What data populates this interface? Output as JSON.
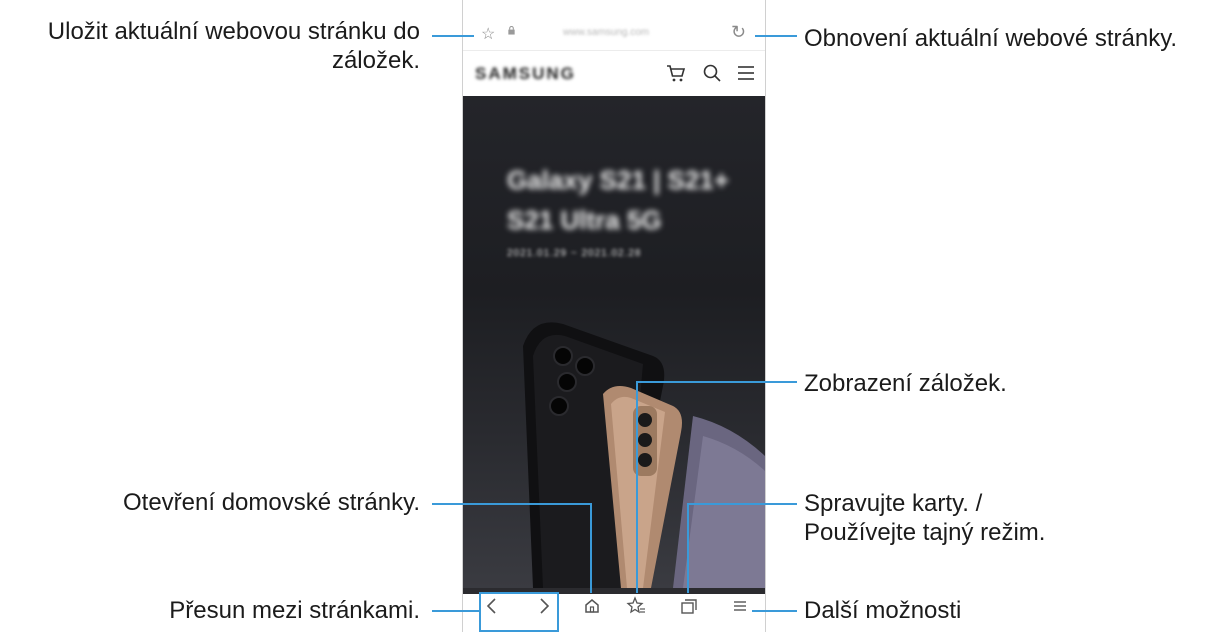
{
  "browser": {
    "url": "www.samsung.com",
    "site_logo": "SAMSUNG",
    "hero_title": "Galaxy S21 | S21+\nS21 Ultra 5G",
    "hero_date": "2021.01.29 ~ 2021.02.28"
  },
  "callouts": {
    "bookmark_save_line1": "Uložit aktuální webovou stránku do",
    "bookmark_save_line2": "záložek.",
    "refresh": "Obnovení aktuální webové stránky.",
    "view_bookmarks": "Zobrazení záložek.",
    "home": "Otevření domovské stránky.",
    "tabs_line1": "Spravujte karty. /",
    "tabs_line2": "Používejte tajný režim.",
    "navigate": "Přesun mezi stránkami.",
    "more": "Další možnosti"
  },
  "icons": {
    "star": "star-icon",
    "lock": "lock-icon",
    "reload": "reload-icon",
    "cart": "cart-icon",
    "search": "search-icon",
    "menu": "menu-icon",
    "back": "back-icon",
    "forward": "forward-icon",
    "home": "home-icon",
    "bookmarks": "bookmarks-icon",
    "tabs": "tabs-icon",
    "more": "more-icon"
  },
  "colors": {
    "callout_line": "#3a9ad9",
    "hero_bg": "#1d1e22"
  }
}
